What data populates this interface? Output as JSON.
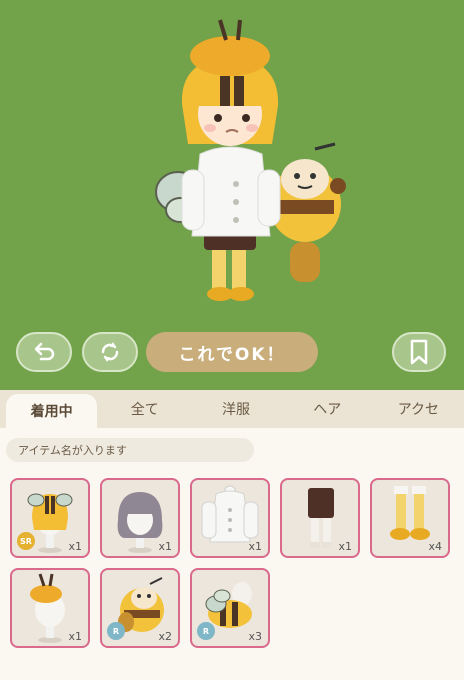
{
  "controls": {
    "confirm_label": "これでOK！"
  },
  "tabs": [
    {
      "label": "着用中",
      "active": true
    },
    {
      "label": "全て",
      "active": false
    },
    {
      "label": "洋服",
      "active": false
    },
    {
      "label": "ヘア",
      "active": false
    },
    {
      "label": "アクセ",
      "active": false
    }
  ],
  "item_name": "アイテム名が入ります",
  "items": [
    {
      "name": "bee-hair",
      "rarity": "SR",
      "count": "x1"
    },
    {
      "name": "grey-hair",
      "rarity": "",
      "count": "x1"
    },
    {
      "name": "white-coat",
      "rarity": "",
      "count": "x1"
    },
    {
      "name": "brown-shorts",
      "rarity": "",
      "count": "x1"
    },
    {
      "name": "yellow-socks",
      "rarity": "",
      "count": "x4"
    },
    {
      "name": "bee-beret",
      "rarity": "",
      "count": "x1"
    },
    {
      "name": "bee-plush",
      "rarity": "R",
      "count": "x2"
    },
    {
      "name": "bee-backpack",
      "rarity": "R",
      "count": "x3"
    }
  ],
  "colors": {
    "stage_bg": "#72a24a",
    "confirm_bg": "#c9ae7c",
    "item_border": "#d96a8c",
    "sr_badge": "#e5b131",
    "r_badge": "#7fb6c8"
  }
}
